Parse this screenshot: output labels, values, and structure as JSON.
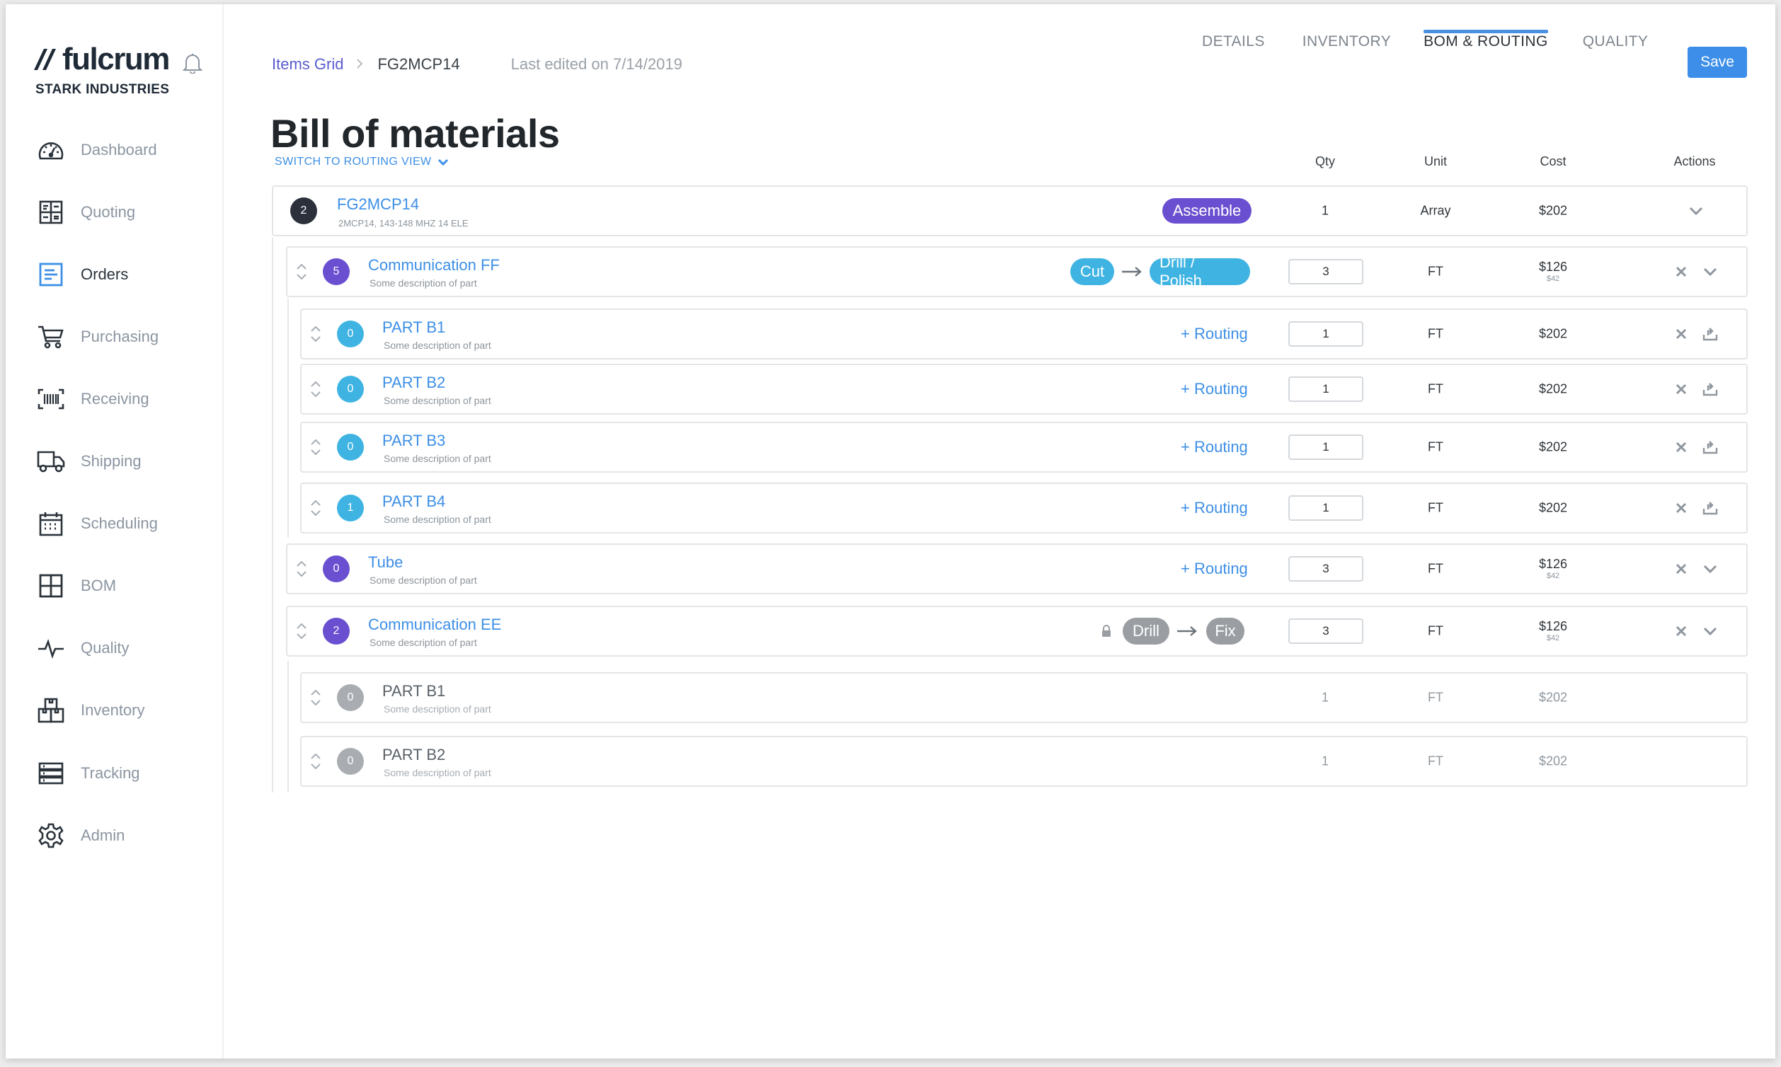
{
  "app": {
    "brand": "fulcrum",
    "company": "STARK INDUSTRIES"
  },
  "sidebar": {
    "items": [
      {
        "label": "Dashboard",
        "icon": "dashboard-icon"
      },
      {
        "label": "Quoting",
        "icon": "quoting-icon"
      },
      {
        "label": "Orders",
        "icon": "orders-icon",
        "active": true
      },
      {
        "label": "Purchasing",
        "icon": "cart-icon"
      },
      {
        "label": "Receiving",
        "icon": "barcode-icon"
      },
      {
        "label": "Shipping",
        "icon": "truck-icon"
      },
      {
        "label": "Scheduling",
        "icon": "calendar-icon"
      },
      {
        "label": "BOM",
        "icon": "grid-icon"
      },
      {
        "label": "Quality",
        "icon": "pulse-icon"
      },
      {
        "label": "Inventory",
        "icon": "boxes-icon"
      },
      {
        "label": "Tracking",
        "icon": "tracking-icon"
      },
      {
        "label": "Admin",
        "icon": "gear-icon"
      }
    ]
  },
  "header": {
    "breadcrumb_link": "Items Grid",
    "breadcrumb_current": "FG2MCP14",
    "last_edited": "Last edited on 7/14/2019",
    "tabs": [
      "DETAILS",
      "INVENTORY",
      "BOM & ROUTING",
      "QUALITY"
    ],
    "active_tab": "BOM & ROUTING",
    "save_label": "Save"
  },
  "main": {
    "title": "Bill of materials",
    "switch_view": "SWITCH TO ROUTING VIEW",
    "columns": {
      "qty": "Qty",
      "unit": "Unit",
      "cost": "Cost",
      "actions": "Actions"
    }
  },
  "rows": [
    {
      "name": "FG2MCP14",
      "desc": "2MCP14, 143-148 MHZ 14 ELE",
      "badge": "2",
      "routing": [
        "Assemble"
      ],
      "qty": "1",
      "unit": "Array",
      "cost": "$202",
      "cost_sub": ""
    },
    {
      "name": "Communication FF",
      "desc": "Some description of part",
      "badge": "5",
      "routing": [
        "Cut",
        "Drill / Polish"
      ],
      "qty": "3",
      "unit": "FT",
      "cost": "$126",
      "cost_sub": "$42"
    },
    {
      "name": "PART B1",
      "desc": "Some description of part",
      "badge": "0",
      "routing_link": "+ Routing",
      "qty": "1",
      "unit": "FT",
      "cost": "$202"
    },
    {
      "name": "PART B2",
      "desc": "Some description of part",
      "badge": "0",
      "routing_link": "+ Routing",
      "qty": "1",
      "unit": "FT",
      "cost": "$202"
    },
    {
      "name": "PART B3",
      "desc": "Some description of part",
      "badge": "0",
      "routing_link": "+ Routing",
      "qty": "1",
      "unit": "FT",
      "cost": "$202"
    },
    {
      "name": "PART B4",
      "desc": "Some description of part",
      "badge": "1",
      "routing_link": "+ Routing",
      "qty": "1",
      "unit": "FT",
      "cost": "$202"
    },
    {
      "name": "Tube",
      "desc": "Some description of part",
      "badge": "0",
      "routing_link": "+ Routing",
      "qty": "3",
      "unit": "FT",
      "cost": "$126",
      "cost_sub": "$42"
    },
    {
      "name": "Communication EE",
      "desc": "Some description of part",
      "badge": "2",
      "routing": [
        "Drill",
        "Fix"
      ],
      "locked": true,
      "qty": "3",
      "unit": "FT",
      "cost": "$126",
      "cost_sub": "$42"
    },
    {
      "name": "PART B1",
      "desc": "Some description of part",
      "badge": "0",
      "qty": "1",
      "unit": "FT",
      "cost": "$202"
    },
    {
      "name": "PART B2",
      "desc": "Some description of part",
      "badge": "0",
      "qty": "1",
      "unit": "FT",
      "cost": "$202"
    }
  ],
  "colors": {
    "accent": "#3d8fe6",
    "assemble": "#6a4fd0",
    "routing_pill": "#3fb4e2",
    "locked_pill": "#9a9ea3",
    "badge_dark": "#2b303b",
    "badge_purple": "#6a4fd0",
    "badge_cyan": "#3fb4e2",
    "badge_gray": "#a9adb2"
  }
}
